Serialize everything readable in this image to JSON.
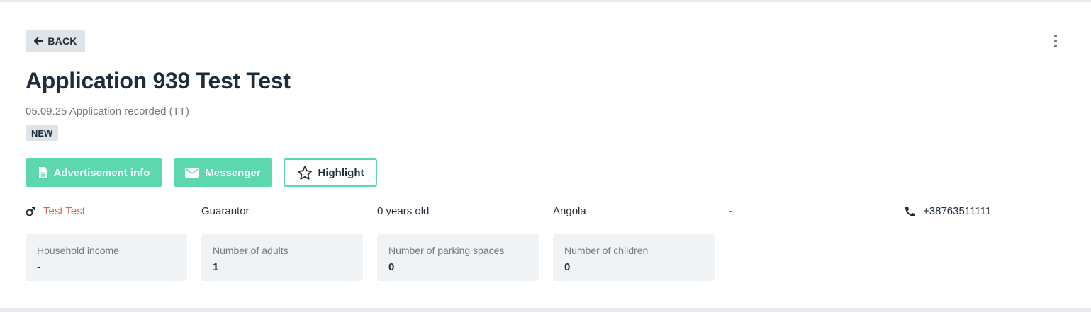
{
  "header": {
    "back_label": "BACK",
    "title": "Application 939 Test Test",
    "subtitle": "05.09.25 Application recorded (TT)",
    "status_badge": "NEW"
  },
  "actions": {
    "advertisement_info": "Advertisement info",
    "messenger": "Messenger",
    "highlight": "Highlight"
  },
  "applicant": {
    "gender_icon": "male-icon",
    "name": "Test Test",
    "role": "Guarantor",
    "age": "0 years old",
    "country": "Angola",
    "extra": "-",
    "phone_icon": "phone-icon",
    "phone": "+38763511111"
  },
  "stats": [
    {
      "label": "Household income",
      "value": "-"
    },
    {
      "label": "Number of adults",
      "value": "1"
    },
    {
      "label": "Number of parking spaces",
      "value": "0"
    },
    {
      "label": "Number of children",
      "value": "0"
    }
  ],
  "colors": {
    "accent": "#5cd8ac",
    "name_link": "#d46a55",
    "title": "#1f2d3a",
    "muted": "#6f7a85"
  }
}
